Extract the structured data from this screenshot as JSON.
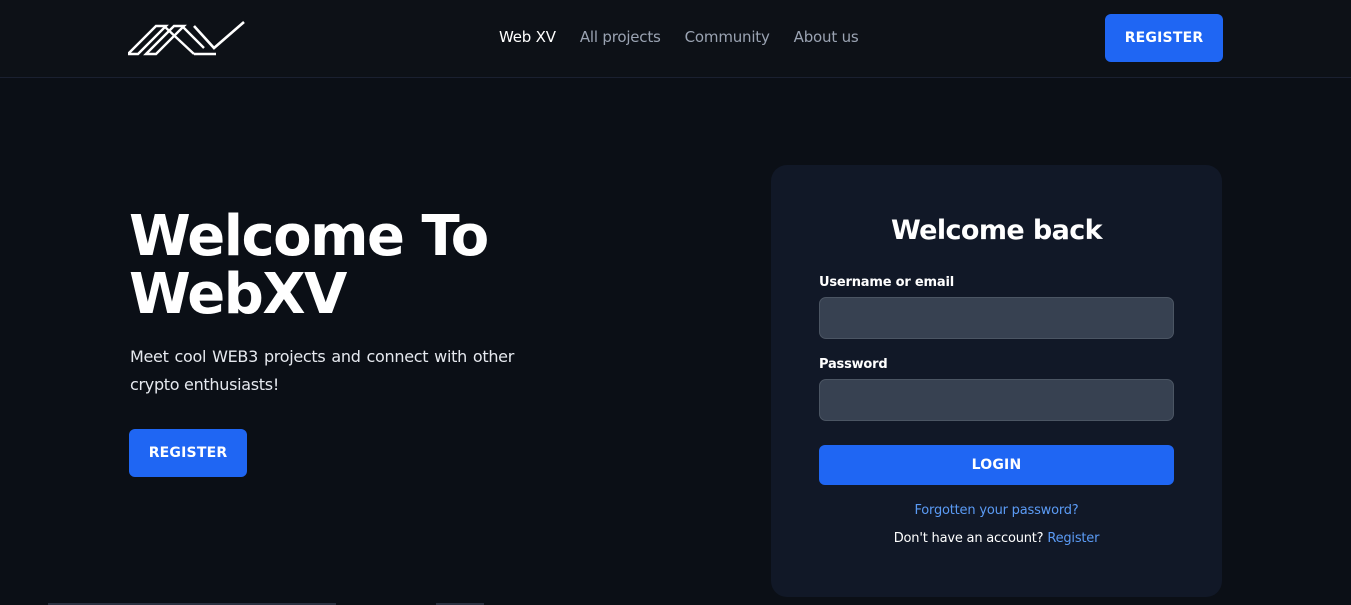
{
  "header": {
    "logo_icon": "xv-logo",
    "nav": [
      {
        "label": "Web XV",
        "active": true
      },
      {
        "label": "All projects",
        "active": false
      },
      {
        "label": "Community",
        "active": false
      },
      {
        "label": "About us",
        "active": false
      }
    ],
    "register_label": "REGISTER"
  },
  "hero": {
    "title_line1": "Welcome To",
    "title_line2": "WebXV",
    "subtitle": "Meet cool WEB3 projects and connect with other crypto enthusiasts!",
    "register_label": "REGISTER"
  },
  "login": {
    "title": "Welcome back",
    "username_label": "Username or email",
    "username_value": "",
    "password_label": "Password",
    "password_value": "",
    "login_label": "LOGIN",
    "forgot_label": "Forgotten your password?",
    "no_account_text": "Don't have an account?",
    "register_link": "Register"
  },
  "colors": {
    "background": "#0b0f16",
    "header": "#0d1117",
    "card": "#111827",
    "input": "#374151",
    "accent": "#1f66f3",
    "link": "#5b9bf5",
    "muted_text": "#9aa3b2"
  }
}
